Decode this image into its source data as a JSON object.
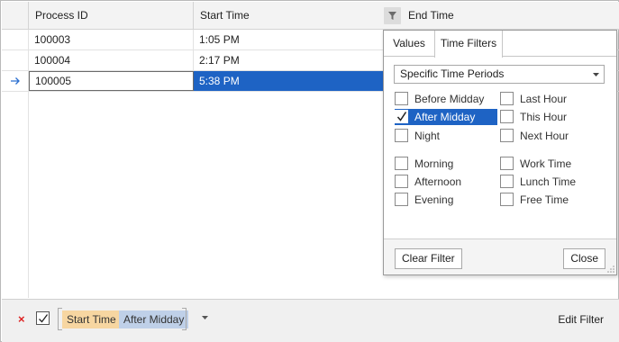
{
  "grid": {
    "columns": {
      "process_id": "Process ID",
      "start_time": "Start Time",
      "end_time": "End Time"
    },
    "rows": [
      {
        "process_id": "100003",
        "start_time": "1:05 PM"
      },
      {
        "process_id": "100004",
        "start_time": "2:17 PM"
      },
      {
        "process_id": "100005",
        "start_time": "5:38 PM"
      }
    ]
  },
  "popup": {
    "tabs": [
      "Values",
      "Time Filters"
    ],
    "active_tab": "Time Filters",
    "select_value": "Specific Time Periods",
    "options": {
      "before_midday": "Before Midday",
      "after_midday": "After Midday",
      "night": "Night",
      "morning": "Morning",
      "afternoon": "Afternoon",
      "evening": "Evening",
      "last_hour": "Last Hour",
      "this_hour": "This Hour",
      "next_hour": "Next Hour",
      "work_time": "Work Time",
      "lunch_time": "Lunch Time",
      "free_time": "Free Time"
    },
    "checked": [
      "After Midday"
    ],
    "clear_label": "Clear Filter",
    "close_label": "Close"
  },
  "filter_bar": {
    "clear_symbol": "×",
    "field": "Start Time",
    "value": "After Midday",
    "edit_label": "Edit Filter"
  },
  "colors": {
    "selection": "#1e63c4",
    "chip_field": "#f7d6a1",
    "chip_value": "#bfd0e8",
    "clear_x": "#dd2222"
  }
}
